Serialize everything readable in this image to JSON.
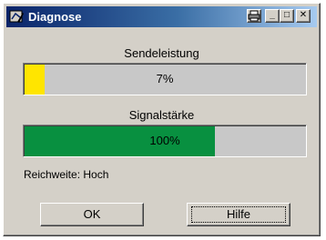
{
  "window": {
    "title": "Diagnose",
    "controls": {
      "minimize": "_",
      "maximize": "□",
      "close": "✕"
    }
  },
  "transmit": {
    "label": "Sendeleistung",
    "value_text": "7%",
    "fraction": 0.07,
    "color": "#ffe500"
  },
  "signal": {
    "label": "Signalstärke",
    "value_text": "100%",
    "fraction": 0.68,
    "color": "#089040"
  },
  "range": {
    "text": "Reichweite: Hoch"
  },
  "buttons": {
    "ok": "OK",
    "help": "Hilfe"
  },
  "colors": {
    "title_start": "#0a246a",
    "title_end": "#a6caf0",
    "face": "#d4d0c8"
  }
}
